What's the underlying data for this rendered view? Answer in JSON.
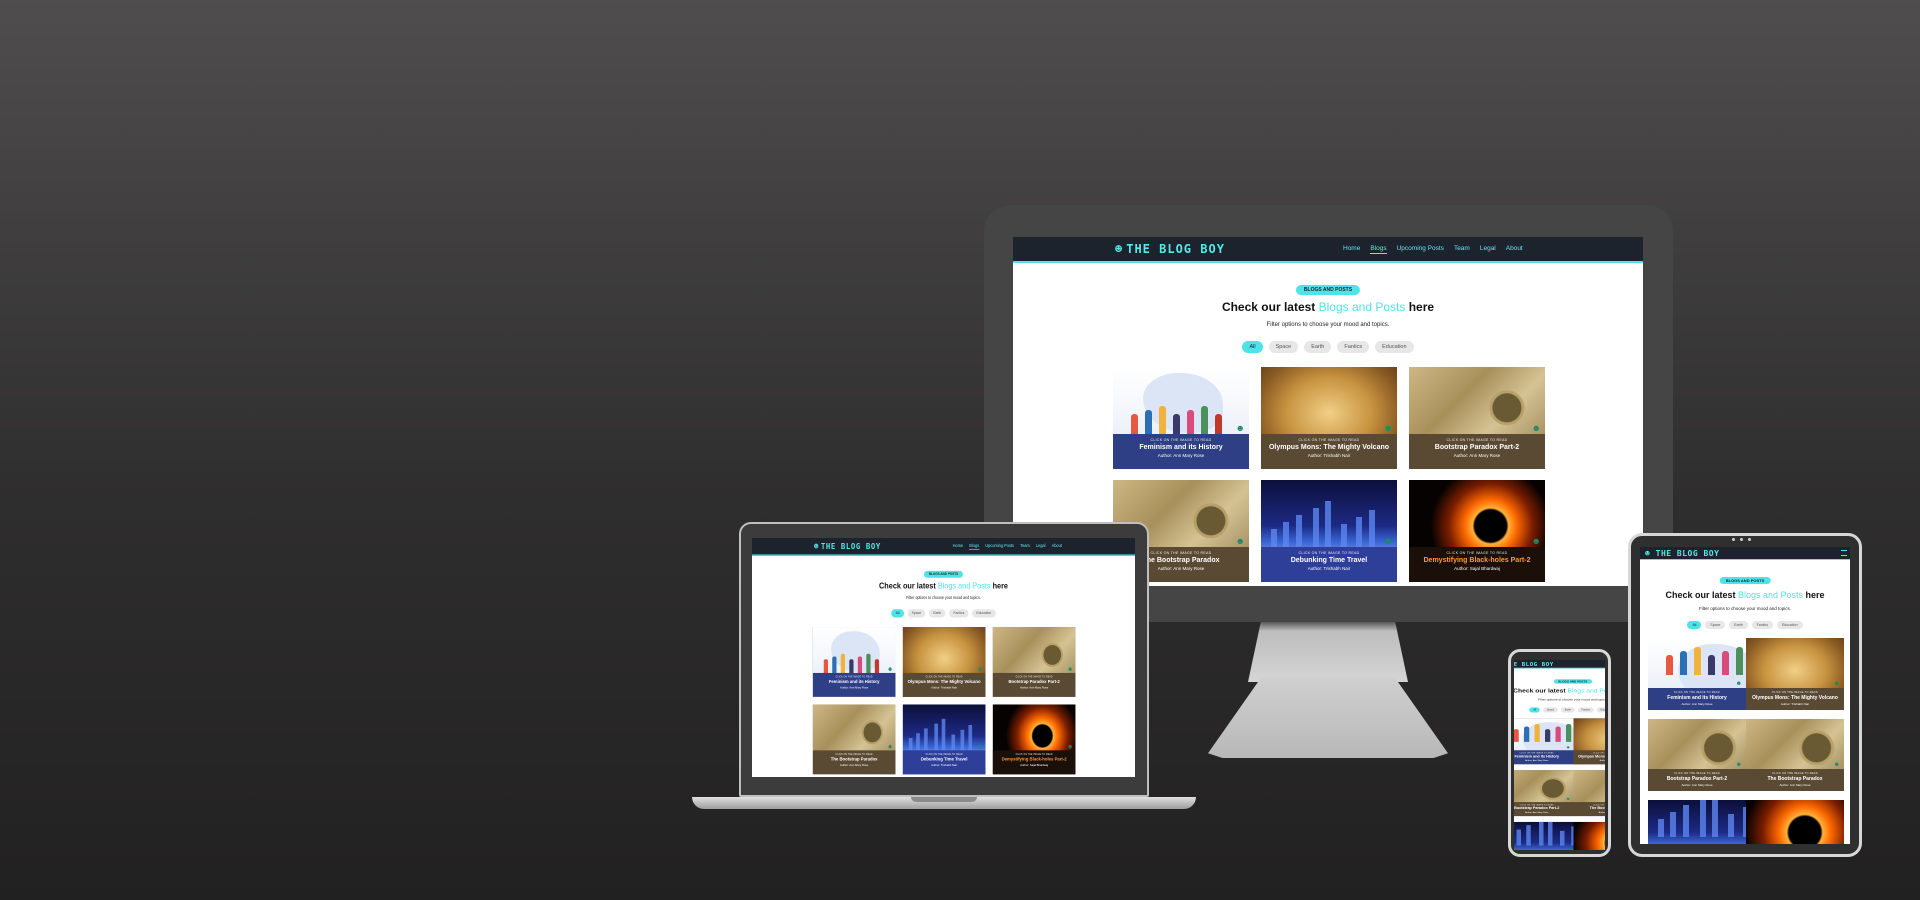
{
  "site": {
    "brand": "THE BLOG BOY",
    "nav": [
      "Home",
      "Blogs",
      "Upcoming Posts",
      "Team",
      "Legal",
      "About"
    ],
    "active_nav": "Blogs",
    "badge": "BLOGS AND POSTS",
    "heading_pre": "Check our latest ",
    "heading_highlight": "Blogs and Posts",
    "heading_post": " here",
    "subheading": "Filter options to choose your mood and topics.",
    "filters": [
      "All",
      "Space",
      "Earth",
      "Fantics",
      "Education"
    ],
    "active_filter": "All",
    "card_prompt": "CLICK ON THE IMAGE TO READ",
    "cards": [
      {
        "title": "Feminism and its History",
        "author": "Author: Ann Mary Rose",
        "theme": "feminism"
      },
      {
        "title": "Olympus Mons: The Mighty Volcano",
        "author": "Author: Trishabh Nair",
        "theme": "mars"
      },
      {
        "title": "Bootstrap Paradox Part-2",
        "author": "Author: Ann Mary Rose",
        "theme": "map"
      },
      {
        "title": "The Bootstrap Paradox",
        "author": "Author: Ann Mary Rose",
        "theme": "map"
      },
      {
        "title": "Debunking Time Travel",
        "author": "Author: Trishabh Nair",
        "theme": "city"
      },
      {
        "title": "Demystifying Black-holes Part-2",
        "author": "Author: Sajal Bhardwaj",
        "theme": "blackhole"
      }
    ]
  },
  "colors": {
    "accent": "#4ee3e8",
    "nav_bg": "#1c232d",
    "device_body": "#454545",
    "background_top": "#4f4d4d",
    "background_bottom": "#222121"
  },
  "icons": {
    "logo": "alien-head-icon",
    "card_corner": "alien-badge-icon",
    "tablet_menu": "hamburger-icon"
  }
}
